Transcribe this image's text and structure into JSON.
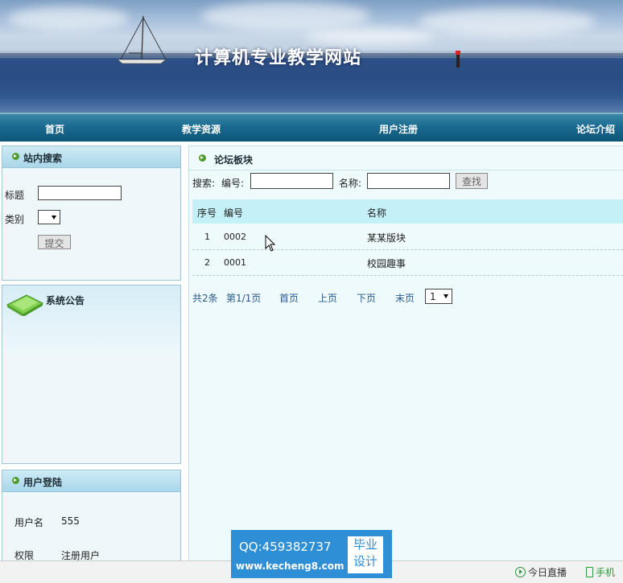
{
  "site": {
    "title": "计算机专业教学网站"
  },
  "nav": {
    "items": [
      "首页",
      "教学资源",
      "用户注册",
      "论坛介绍"
    ]
  },
  "search_panel": {
    "title": "站内搜索",
    "title_label": "标题",
    "title_value": "",
    "category_label": "类别",
    "category_value": "",
    "submit_label": "提交"
  },
  "notice_panel": {
    "title": "系统公告"
  },
  "login_panel": {
    "title": "用户登陆",
    "username_label": "用户名",
    "username_value": "555",
    "role_label": "权限",
    "role_value": "注册用户"
  },
  "forum": {
    "title": "论坛板块",
    "search_label": "搜索:",
    "code_label": "编号:",
    "code_value": "",
    "name_label": "名称:",
    "name_value": "",
    "find_label": "查找",
    "columns": [
      "序号",
      "编号",
      "名称"
    ],
    "rows": [
      {
        "index": "1",
        "code": "0002",
        "name": "某某版块"
      },
      {
        "index": "2",
        "code": "0001",
        "name": "校园趣事"
      }
    ],
    "pager": {
      "total": "共2条",
      "page": "第1/1页",
      "first": "首页",
      "prev": "上页",
      "next": "下页",
      "last": "末页",
      "page_select": "1"
    }
  },
  "watermark": {
    "qq": "QQ:459382737",
    "url": "www.kecheng8.com",
    "tag_line1": "毕业",
    "tag_line2": "设计"
  },
  "status_bar": {
    "live": "今日直播",
    "mobile": "手机"
  },
  "colors": {
    "nav_bg": "#1a6a90",
    "panel_head": "#a9d7ea",
    "table_head": "#c4f0f7",
    "watermark": "#2f8fd6"
  }
}
